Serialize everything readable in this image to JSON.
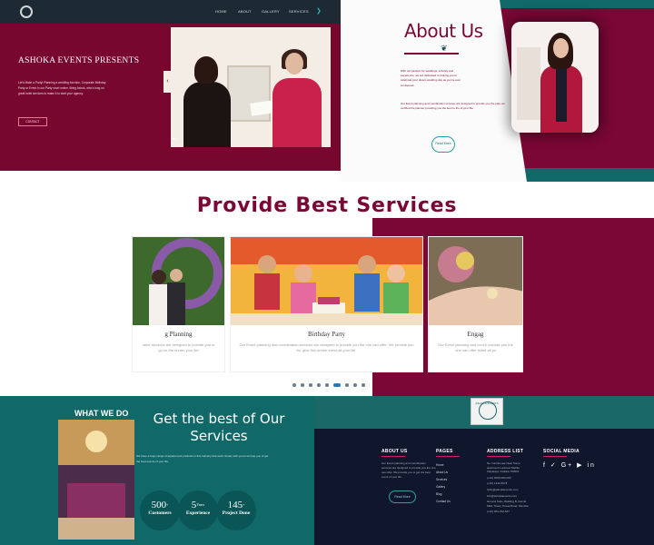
{
  "nav": {
    "items": [
      "HOME",
      "ABOUT",
      "GALLERY",
      "SERVICES"
    ]
  },
  "hero": {
    "brand": "ASHOKA EVENTS PRESENTS",
    "blurb": "Let's Make a Party! Planning a wedding function, Corporate Birthday Party or Event in our Party short notice. Bring Ashok, who's long on great hotel services to make it to start your agency.",
    "button_label": "CONTACT",
    "slider_arrows": {
      "left": "‹",
      "right": "›"
    },
    "slider_dots": "● ○"
  },
  "about": {
    "title": "About Us",
    "text1": "With our passion for weddings, a family and experience, we are dedicated to helping you to celebrate your dream wedding day as you've ever envisioned.",
    "text2": "Our Event planning and coordination services are designed to provide you the plan our certified the planner providing you the best to the of your life.",
    "button_label": "Read More"
  },
  "services": {
    "title": "Provide Best Services",
    "cards": [
      {
        "title": "g Planning",
        "text": "other services are designed to provide you to go on the dream your life"
      },
      {
        "title": "Birthday Party",
        "text": "Our Event planning and coordination services are designed to provide you the one can offer. We provide you for, give this dream event all your life."
      },
      {
        "title": "Engag",
        "text": "Our Event planning and coor b provide you the one can offer event all yo"
      }
    ],
    "dots": 9,
    "active_dot": 5
  },
  "what_we_do": {
    "label": "WHAT WE DO",
    "heading": "Get the best of Our Services",
    "description": "We have a huge range of apparel and products in this industry that work closely with you to let help you to get the best events of your life.",
    "stats": [
      {
        "number": "500",
        "sup": "+",
        "label": "Customers"
      },
      {
        "number": "5",
        "sup": "Years",
        "label": "Experience"
      },
      {
        "number": "145",
        "sup": "+",
        "label": "Project Done"
      }
    ]
  },
  "footer": {
    "badge_text": "ASHOKA EVENTS",
    "about_head": "ABOUT US",
    "about_text": "Our Event planning and coordination services are designed to provide you the one can offer. We provide you to get the best event of your life.",
    "button_label": "Read More",
    "pages_head": "PAGES",
    "pages": [
      "Home",
      "About Us",
      "Services",
      "Gallery",
      "Blog",
      "Contact Us"
    ],
    "address_head": "ADDRESS LIST",
    "address_rows": [
      "No. Farmhouse Near Some apartment Lucknow Mahila Vidyalaya, Kolkata 700001",
      "(+91) 9000-000-000",
      "(+91) 1234-5678",
      "hello@ashokaevents.com",
      "info@ashokaevents.com",
      "Ground Suite, Building B, Kamla Mills, Tower, Powai Road, Mumbai",
      "(+91) 901-234-567"
    ],
    "social_head": "SOCIAL MEDIA",
    "social_icons": "f  ✓  G+  ▶  in"
  },
  "colors": {
    "maroon": "#7a0735",
    "teal": "#106868",
    "navy": "#10172c"
  }
}
